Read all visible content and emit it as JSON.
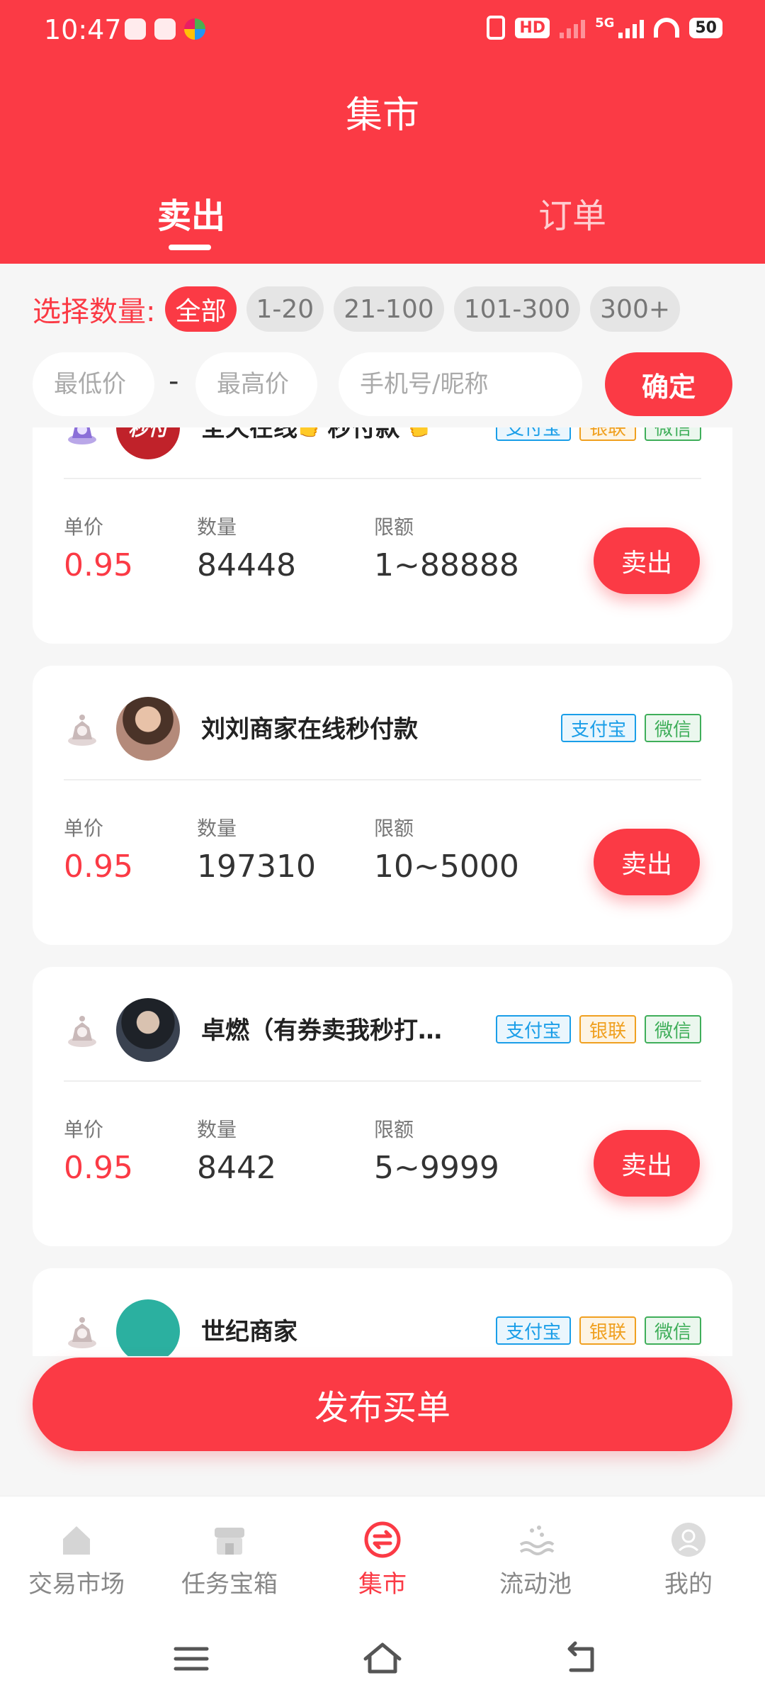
{
  "status_bar": {
    "time": "10:47",
    "signal_label": "5G",
    "hd_label": "HD",
    "battery": "50"
  },
  "header": {
    "title": "集市",
    "tabs": [
      {
        "label": "卖出",
        "active": true
      },
      {
        "label": "订单",
        "active": false
      }
    ]
  },
  "filters": {
    "quantity_label": "选择数量:",
    "chips": [
      "全部",
      "1-20",
      "21-100",
      "101-300",
      "300+"
    ],
    "active_chip": "全部",
    "min_price_placeholder": "最低价",
    "separator": "-",
    "max_price_placeholder": "最高价",
    "phone_placeholder": "手机号/昵称",
    "confirm_label": "确定"
  },
  "card_labels": {
    "price": "单价",
    "quantity": "数量",
    "limit": "限额",
    "sell_button": "卖出"
  },
  "merchants": [
    {
      "name": "全天在线👉秒付款👈",
      "avatar_text": "秒付",
      "level_icon": "purple-gem-icon",
      "tags": [
        "支付宝",
        "银联",
        "微信"
      ],
      "price": "0.95",
      "quantity": "84448",
      "limit": "1~88888"
    },
    {
      "name": "刘刘商家在线秒付款",
      "avatar_text": "",
      "level_icon": "silver-gem-icon",
      "tags": [
        "支付宝",
        "微信"
      ],
      "price": "0.95",
      "quantity": "197310",
      "limit": "10~5000"
    },
    {
      "name": "卓燃（有券卖我秒打…",
      "avatar_text": "",
      "level_icon": "silver-gem-icon",
      "tags": [
        "支付宝",
        "银联",
        "微信"
      ],
      "price": "0.95",
      "quantity": "8442",
      "limit": "5~9999"
    },
    {
      "name": "世纪商家",
      "avatar_text": "",
      "level_icon": "silver-gem-icon",
      "tags": [
        "支付宝",
        "银联",
        "微信"
      ],
      "price": "",
      "quantity": "",
      "limit": ""
    }
  ],
  "publish_button": "发布买单",
  "bottom_nav": [
    {
      "label": "交易市场",
      "icon": "home-icon",
      "active": false
    },
    {
      "label": "任务宝箱",
      "icon": "store-icon",
      "active": false
    },
    {
      "label": "集市",
      "icon": "exchange-icon",
      "active": true
    },
    {
      "label": "流动池",
      "icon": "pool-icon",
      "active": false
    },
    {
      "label": "我的",
      "icon": "profile-icon",
      "active": false
    }
  ],
  "colors": {
    "primary": "#fb3a45",
    "alipay": "#1a9ee8",
    "unionpay": "#f0a020",
    "wechat": "#3fae5a"
  }
}
